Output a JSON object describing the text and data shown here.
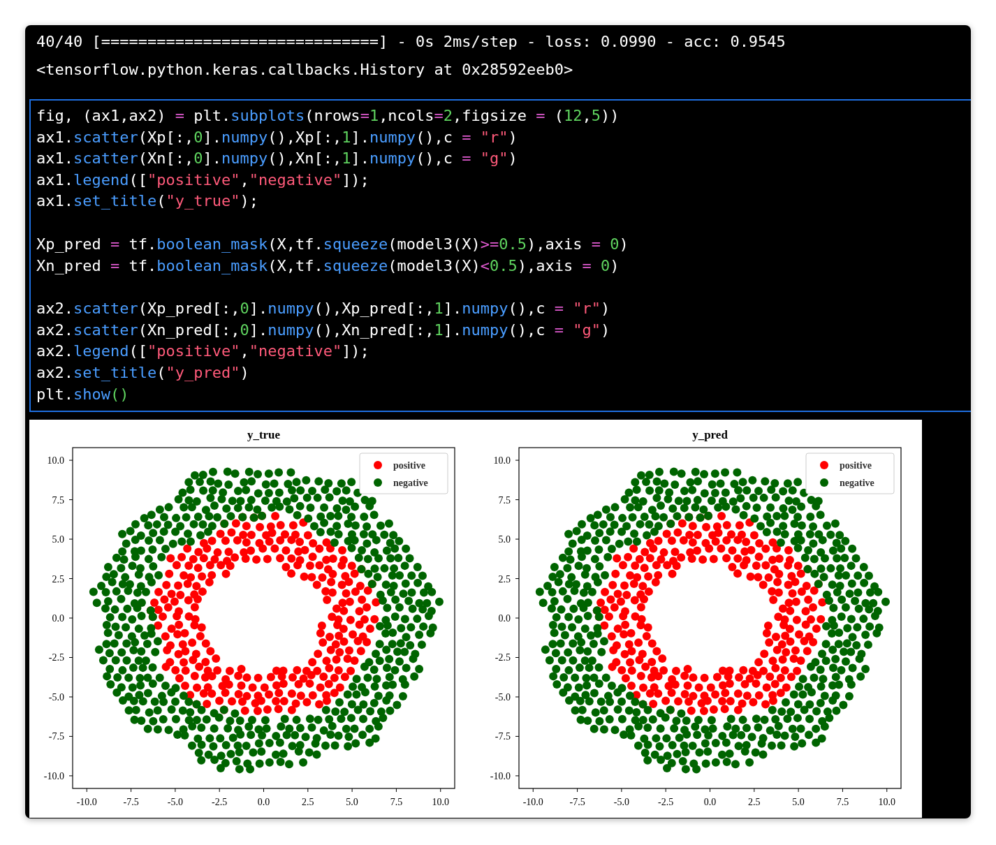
{
  "output_lines": [
    "40/40 [==============================] - 0s 2ms/step - loss: 0.0990 - acc: 0.9545",
    "<tensorflow.python.keras.callbacks.History at 0x28592eeb0>"
  ],
  "code_cell": {
    "selected": true,
    "blocks": [
      [
        [
          {
            "kind": "plain",
            "text": "fig, (ax1,ax2) "
          },
          {
            "kind": "op",
            "text": "="
          },
          {
            "kind": "plain",
            "text": " plt."
          },
          {
            "kind": "func",
            "text": "subplots"
          },
          {
            "kind": "plain",
            "text": "(nrows"
          },
          {
            "kind": "op",
            "text": "="
          },
          {
            "kind": "num",
            "text": "1"
          },
          {
            "kind": "plain",
            "text": ",ncols"
          },
          {
            "kind": "op",
            "text": "="
          },
          {
            "kind": "num",
            "text": "2"
          },
          {
            "kind": "plain",
            "text": ",figsize "
          },
          {
            "kind": "op",
            "text": "="
          },
          {
            "kind": "plain",
            "text": " ("
          },
          {
            "kind": "num",
            "text": "12"
          },
          {
            "kind": "plain",
            "text": ","
          },
          {
            "kind": "num",
            "text": "5"
          },
          {
            "kind": "plain",
            "text": "))"
          }
        ],
        [
          {
            "kind": "plain",
            "text": "ax1."
          },
          {
            "kind": "func",
            "text": "scatter"
          },
          {
            "kind": "plain",
            "text": "(Xp[:,"
          },
          {
            "kind": "num",
            "text": "0"
          },
          {
            "kind": "plain",
            "text": "]."
          },
          {
            "kind": "func",
            "text": "numpy"
          },
          {
            "kind": "plain",
            "text": "(),Xp[:,"
          },
          {
            "kind": "num",
            "text": "1"
          },
          {
            "kind": "plain",
            "text": "]."
          },
          {
            "kind": "func",
            "text": "numpy"
          },
          {
            "kind": "plain",
            "text": "(),c "
          },
          {
            "kind": "op",
            "text": "="
          },
          {
            "kind": "str",
            "text": " \"r\""
          },
          {
            "kind": "plain",
            "text": ")"
          }
        ],
        [
          {
            "kind": "plain",
            "text": "ax1."
          },
          {
            "kind": "func",
            "text": "scatter"
          },
          {
            "kind": "plain",
            "text": "(Xn[:,"
          },
          {
            "kind": "num",
            "text": "0"
          },
          {
            "kind": "plain",
            "text": "]."
          },
          {
            "kind": "func",
            "text": "numpy"
          },
          {
            "kind": "plain",
            "text": "(),Xn[:,"
          },
          {
            "kind": "num",
            "text": "1"
          },
          {
            "kind": "plain",
            "text": "]."
          },
          {
            "kind": "func",
            "text": "numpy"
          },
          {
            "kind": "plain",
            "text": "(),c "
          },
          {
            "kind": "op",
            "text": "="
          },
          {
            "kind": "str",
            "text": " \"g\""
          },
          {
            "kind": "plain",
            "text": ")"
          }
        ],
        [
          {
            "kind": "plain",
            "text": "ax1."
          },
          {
            "kind": "func",
            "text": "legend"
          },
          {
            "kind": "plain",
            "text": "(["
          },
          {
            "kind": "str",
            "text": "\"positive\""
          },
          {
            "kind": "plain",
            "text": ","
          },
          {
            "kind": "str",
            "text": "\"negative\""
          },
          {
            "kind": "plain",
            "text": "]);"
          }
        ],
        [
          {
            "kind": "plain",
            "text": "ax1."
          },
          {
            "kind": "func",
            "text": "set_title"
          },
          {
            "kind": "plain",
            "text": "("
          },
          {
            "kind": "str",
            "text": "\"y_true\""
          },
          {
            "kind": "plain",
            "text": ");"
          }
        ]
      ],
      [
        [
          {
            "kind": "plain",
            "text": "Xp_pred "
          },
          {
            "kind": "op",
            "text": "="
          },
          {
            "kind": "plain",
            "text": " tf."
          },
          {
            "kind": "func",
            "text": "boolean_mask"
          },
          {
            "kind": "plain",
            "text": "(X,tf."
          },
          {
            "kind": "func",
            "text": "squeeze"
          },
          {
            "kind": "plain",
            "text": "(model3(X)"
          },
          {
            "kind": "op",
            "text": ">="
          },
          {
            "kind": "num",
            "text": "0.5"
          },
          {
            "kind": "plain",
            "text": "),axis "
          },
          {
            "kind": "op",
            "text": "="
          },
          {
            "kind": "num",
            "text": " 0"
          },
          {
            "kind": "plain",
            "text": ")"
          }
        ],
        [
          {
            "kind": "plain",
            "text": "Xn_pred "
          },
          {
            "kind": "op",
            "text": "="
          },
          {
            "kind": "plain",
            "text": " tf."
          },
          {
            "kind": "func",
            "text": "boolean_mask"
          },
          {
            "kind": "plain",
            "text": "(X,tf."
          },
          {
            "kind": "func",
            "text": "squeeze"
          },
          {
            "kind": "plain",
            "text": "(model3(X)"
          },
          {
            "kind": "op",
            "text": "<"
          },
          {
            "kind": "num",
            "text": "0.5"
          },
          {
            "kind": "plain",
            "text": "),axis "
          },
          {
            "kind": "op",
            "text": "="
          },
          {
            "kind": "num",
            "text": " 0"
          },
          {
            "kind": "plain",
            "text": ")"
          }
        ]
      ],
      [
        [
          {
            "kind": "plain",
            "text": "ax2."
          },
          {
            "kind": "func",
            "text": "scatter"
          },
          {
            "kind": "plain",
            "text": "(Xp_pred[:,"
          },
          {
            "kind": "num",
            "text": "0"
          },
          {
            "kind": "plain",
            "text": "]."
          },
          {
            "kind": "func",
            "text": "numpy"
          },
          {
            "kind": "plain",
            "text": "(),Xp_pred[:,"
          },
          {
            "kind": "num",
            "text": "1"
          },
          {
            "kind": "plain",
            "text": "]."
          },
          {
            "kind": "func",
            "text": "numpy"
          },
          {
            "kind": "plain",
            "text": "(),c "
          },
          {
            "kind": "op",
            "text": "="
          },
          {
            "kind": "str",
            "text": " \"r\""
          },
          {
            "kind": "plain",
            "text": ")"
          }
        ],
        [
          {
            "kind": "plain",
            "text": "ax2."
          },
          {
            "kind": "func",
            "text": "scatter"
          },
          {
            "kind": "plain",
            "text": "(Xn_pred[:,"
          },
          {
            "kind": "num",
            "text": "0"
          },
          {
            "kind": "plain",
            "text": "]."
          },
          {
            "kind": "func",
            "text": "numpy"
          },
          {
            "kind": "plain",
            "text": "(),Xn_pred[:,"
          },
          {
            "kind": "num",
            "text": "1"
          },
          {
            "kind": "plain",
            "text": "]."
          },
          {
            "kind": "func",
            "text": "numpy"
          },
          {
            "kind": "plain",
            "text": "(),c "
          },
          {
            "kind": "op",
            "text": "="
          },
          {
            "kind": "str",
            "text": " \"g\""
          },
          {
            "kind": "plain",
            "text": ")"
          }
        ],
        [
          {
            "kind": "plain",
            "text": "ax2."
          },
          {
            "kind": "func",
            "text": "legend"
          },
          {
            "kind": "plain",
            "text": "(["
          },
          {
            "kind": "str",
            "text": "\"positive\""
          },
          {
            "kind": "plain",
            "text": ","
          },
          {
            "kind": "str",
            "text": "\"negative\""
          },
          {
            "kind": "plain",
            "text": "]);"
          }
        ],
        [
          {
            "kind": "plain",
            "text": "ax2."
          },
          {
            "kind": "func",
            "text": "set_title"
          },
          {
            "kind": "plain",
            "text": "("
          },
          {
            "kind": "str",
            "text": "\"y_pred\""
          },
          {
            "kind": "plain",
            "text": ")"
          }
        ],
        [
          {
            "kind": "plain",
            "text": "plt."
          },
          {
            "kind": "func",
            "text": "show"
          },
          {
            "kind": "num",
            "text": "()"
          }
        ]
      ]
    ]
  },
  "figure": {
    "plots": [
      {
        "title": "y_true",
        "x_tick_labels": [
          "-10.0",
          "-7.5",
          "-5.0",
          "-2.5",
          "0.0",
          "2.5",
          "5.0",
          "7.5",
          "10.0"
        ],
        "y_tick_labels": [
          "10.0",
          "7.5",
          "5.0",
          "2.5",
          "0.0",
          "-2.5",
          "-5.0",
          "-7.5",
          "-10.0"
        ],
        "legend": [
          {
            "label": "positive",
            "color": "#ff0000"
          },
          {
            "label": "negative",
            "color": "#006400"
          }
        ]
      },
      {
        "title": "y_pred",
        "x_tick_labels": [
          "-10.0",
          "-7.5",
          "-5.0",
          "-2.5",
          "0.0",
          "2.5",
          "5.0",
          "7.5",
          "10.0"
        ],
        "y_tick_labels": [
          "10.0",
          "7.5",
          "5.0",
          "2.5",
          "0.0",
          "-2.5",
          "-5.0",
          "-7.5",
          "-10.0"
        ],
        "legend": [
          {
            "label": "positive",
            "color": "#ff0000"
          },
          {
            "label": "negative",
            "color": "#006400"
          }
        ]
      }
    ]
  }
}
